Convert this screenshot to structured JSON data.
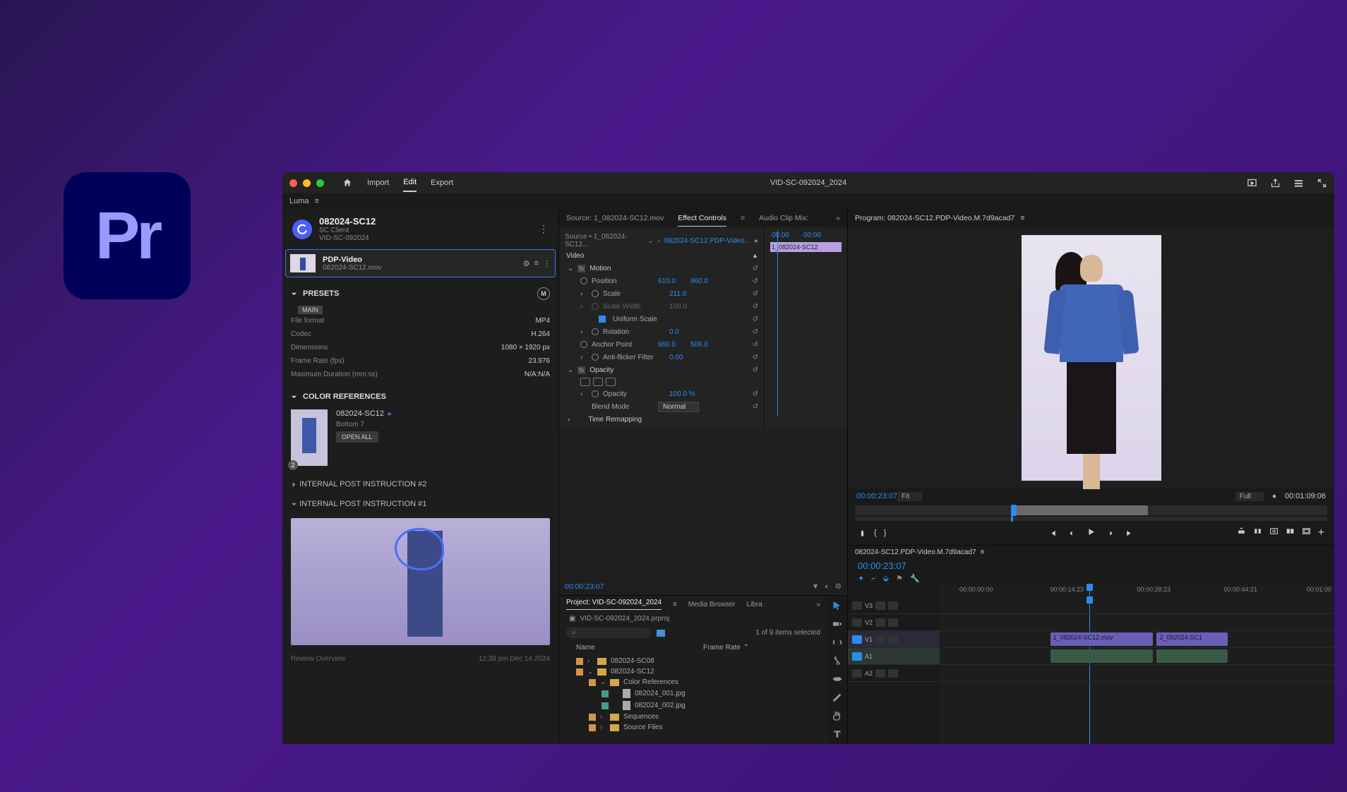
{
  "titlebar": {
    "tabs": {
      "import": "Import",
      "edit": "Edit",
      "export": "Export"
    },
    "project_name": "VID-SC-092024_2024"
  },
  "luma_panel": {
    "tab": "Luma",
    "asset_title": "082024-SC12",
    "asset_client": "SC Client",
    "asset_job": "VID-SC-092024",
    "clip_name": "PDP-Video",
    "clip_file": "082024-SC12.mov",
    "presets_label": "PRESETS",
    "pill_main": "MAIN",
    "circle_m": "M",
    "presets": [
      {
        "k": "File format",
        "v": "MP4"
      },
      {
        "k": "Codec",
        "v": "H.264"
      },
      {
        "k": "Dimensions",
        "v": "1080 × 1920 px"
      },
      {
        "k": "Frame Rate (fps)",
        "v": "23.976"
      },
      {
        "k": "Maximum Duration (mm:ss)",
        "v": "N/A:N/A"
      }
    ],
    "colref_label": "COLOR REFERENCES",
    "colref_name": "082024-SC12",
    "colref_sub": "Bottom 7",
    "colref_badge": "2",
    "open_all": "OPEN ALL",
    "instr2": "INTERNAL POST INSTRUCTION #2",
    "instr1": "INTERNAL POST INSTRUCTION #1",
    "footer_left": "Review Overview",
    "footer_right": "12:38 pm Dec 14 2024"
  },
  "center": {
    "tabs": {
      "source": "Source: 1_082024-SC12.mov",
      "effect": "Effect Controls",
      "audio": "Audio Clip Mix:"
    },
    "source_clip": "Source • 1_082024-SC12...",
    "seq_link": "082024-SC12.PDP-Video...",
    "video_label": "Video",
    "tc_a": "00.00",
    "tc_b": "00:00",
    "clip_timeline": "1_082024-SC12",
    "motion": "Motion",
    "position": {
      "l": "Position",
      "x": "610.0",
      "y": "960.0"
    },
    "scale": {
      "l": "Scale",
      "v": "211.0"
    },
    "scale_width": {
      "l": "Scale Width",
      "v": "100.0"
    },
    "uniform": "Uniform Scale",
    "rotation": {
      "l": "Rotation",
      "v": "0.0"
    },
    "anchor": {
      "l": "Anchor Point",
      "x": "960.0",
      "y": "506.0"
    },
    "flicker": {
      "l": "Anti-flicker Filter",
      "v": "0.00"
    },
    "opacity_label": "Opacity",
    "opacity": {
      "l": "Opacity",
      "v": "100.0 %"
    },
    "blend": {
      "l": "Blend Mode",
      "v": "Normal"
    },
    "time_remap": "Time Remapping",
    "tc_foot": "00:00:23:07"
  },
  "project": {
    "tabs": {
      "project": "Project: VID-SC-092024_2024",
      "media": "Media Browser",
      "lib": "Libra"
    },
    "file": "VID-SC-092024_2024.prproj",
    "search_ph": "Search",
    "count": "1 of 9 items selected",
    "headers": {
      "name": "Name",
      "fr": "Frame Rate"
    },
    "tree": [
      {
        "lvl": 1,
        "type": "folder",
        "color": "cb-orange",
        "name": "082024-SC08"
      },
      {
        "lvl": 1,
        "type": "folder",
        "color": "cb-orange",
        "name": "082024-SC12",
        "open": true
      },
      {
        "lvl": 2,
        "type": "folder",
        "color": "cb-orange",
        "name": "Color References",
        "open": true
      },
      {
        "lvl": 3,
        "type": "file",
        "color": "cb-teal",
        "name": "082024_001.jpg"
      },
      {
        "lvl": 3,
        "type": "file",
        "color": "cb-teal",
        "name": "082024_002.jpg"
      },
      {
        "lvl": 2,
        "type": "folder",
        "color": "cb-orange",
        "name": "Sequences"
      },
      {
        "lvl": 2,
        "type": "folder",
        "color": "cb-orange",
        "name": "Source Files"
      }
    ]
  },
  "program": {
    "tab": "Program: 082024-SC12.PDP-Video.M.7d9acad7",
    "tc_current": "00:00:23:07",
    "fit": "Fit",
    "full": "Full",
    "tc_total": "00:01:09:06"
  },
  "sequence": {
    "tab": "082024-SC12.PDP-Video.M.7d9acad7",
    "tc": "00:00:23:07",
    "ruler": [
      {
        "pos": 5,
        "t": "00:00:00:00"
      },
      {
        "pos": 28,
        "t": "00:00:14:23"
      },
      {
        "pos": 50,
        "t": "00:00:28:23"
      },
      {
        "pos": 72,
        "t": "00:00:44:21"
      },
      {
        "pos": 93,
        "t": "00:01:00"
      }
    ],
    "clips": {
      "v1a": "1_082024-SC12.mov",
      "v1b": "2_082024-SC1"
    }
  }
}
